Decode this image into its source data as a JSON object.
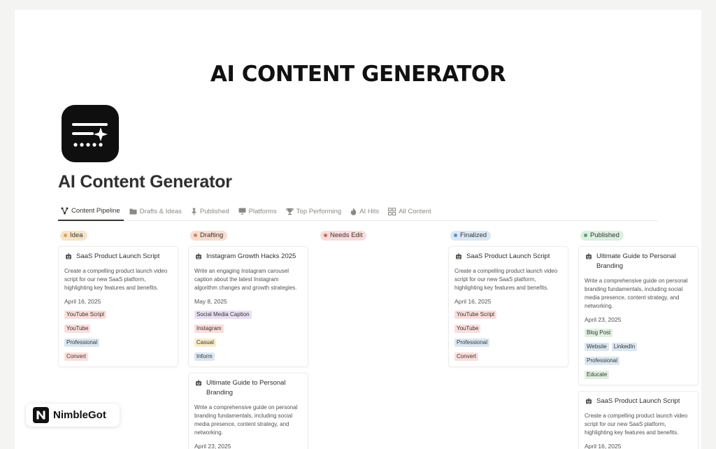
{
  "hero": {
    "title": "AI CONTENT GENERATOR"
  },
  "page": {
    "title": "AI Content Generator",
    "icon": "ai-generator-icon"
  },
  "tabs": [
    {
      "label": "Content Pipeline",
      "icon": "pipeline-icon",
      "active": true
    },
    {
      "label": "Drafts & Ideas",
      "icon": "folder-icon"
    },
    {
      "label": "Published",
      "icon": "pushpin-icon"
    },
    {
      "label": "Platforms",
      "icon": "monitor-icon"
    },
    {
      "label": "Top Performing",
      "icon": "trophy-icon"
    },
    {
      "label": "AI Hits",
      "icon": "fire-icon"
    },
    {
      "label": "All Content",
      "icon": "grid-icon"
    }
  ],
  "columns": [
    {
      "label": "Idea",
      "color": "#f5e4c9",
      "dot": "#d9a54a",
      "cards": [
        {
          "title": "SaaS Product Launch Script",
          "desc": "Create a compelling product launch video script for our new SaaS platform, highlighting key features and benefits.",
          "date": "April 16, 2025",
          "tags": [
            [
              "YouTube Script"
            ],
            [
              "YouTube"
            ],
            [
              "Professional"
            ],
            [
              "Convert"
            ]
          ]
        }
      ]
    },
    {
      "label": "Drafting",
      "color": "#f8ddd0",
      "dot": "#d9835a",
      "cards": [
        {
          "title": "Instagram Growth Hacks 2025",
          "desc": "Write an engaging Instagram carousel caption about the latest Instagram algorithm changes and growth strategies.",
          "date": "May 8, 2025",
          "tags": [
            [
              "Social Media Caption"
            ],
            [
              "Instagram"
            ],
            [
              "Casual"
            ],
            [
              "Inform"
            ]
          ]
        },
        {
          "title": "Ultimate Guide to Personal Branding",
          "desc": "Write a comprehensive guide on personal branding fundamentals, including social media presence, content strategy, and networking.",
          "date": "April 23, 2025",
          "tags": []
        }
      ]
    },
    {
      "label": "Needs Edit",
      "color": "#f9dcdc",
      "dot": "#d9645f",
      "cards": []
    },
    {
      "label": "Finalized",
      "color": "#dbe8f5",
      "dot": "#5a8fd9",
      "cards": [
        {
          "title": "SaaS Product Launch Script",
          "desc": "Create a compelling product launch video script for our new SaaS platform, highlighting key features and benefits.",
          "date": "April 16, 2025",
          "tags": [
            [
              "YouTube Script"
            ],
            [
              "YouTube"
            ],
            [
              "Professional"
            ],
            [
              "Convert"
            ]
          ]
        }
      ]
    },
    {
      "label": "Published",
      "color": "#dcefe0",
      "dot": "#4fa86a",
      "cards": [
        {
          "title": "Ultimate Guide to Personal Branding",
          "desc": "Write a comprehensive guide on personal branding fundamentals, including social media presence, content strategy, and networking.",
          "date": "April 23, 2025",
          "tags": [
            [
              "Blog Post"
            ],
            [
              "Website",
              "LinkedIn"
            ],
            [
              "Professional"
            ],
            [
              "Educate"
            ]
          ]
        },
        {
          "title": "SaaS Product Launch Script",
          "desc": "Create a compelling product launch video script for our new SaaS platform, highlighting key features and benefits.",
          "date": "April 16, 2025",
          "tags": []
        }
      ]
    }
  ],
  "tag_colors": {
    "YouTube Script": "#fbdedd",
    "YouTube": "#fbdedd",
    "Professional": "#dae7f2",
    "Convert": "#fbdedd",
    "Social Media Caption": "#e9e0f3",
    "Instagram": "#fbdedd",
    "Casual": "#f8ecc9",
    "Inform": "#dae7f2",
    "Blog Post": "#dff0e1",
    "Website": "#dae7f2",
    "LinkedIn": "#dae7f2",
    "Educate": "#dff0e1"
  },
  "watermark": {
    "brand": "NimbleGot",
    "logo": "N"
  }
}
